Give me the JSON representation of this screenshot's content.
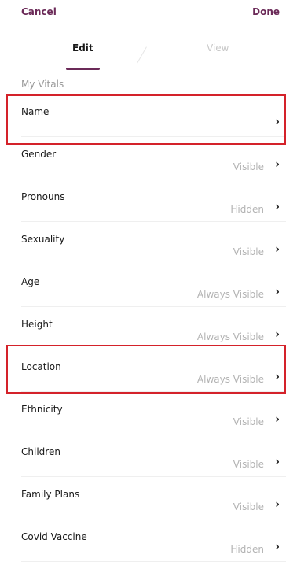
{
  "nav": {
    "cancel_label": "Cancel",
    "done_label": "Done"
  },
  "tabs": {
    "edit_label": "Edit",
    "view_label": "View"
  },
  "section": {
    "title": "My Vitals"
  },
  "rows": [
    {
      "label": "Name",
      "value": ""
    },
    {
      "label": "Gender",
      "value": "Visible"
    },
    {
      "label": "Pronouns",
      "value": "Hidden"
    },
    {
      "label": "Sexuality",
      "value": "Visible"
    },
    {
      "label": "Age",
      "value": "Always Visible"
    },
    {
      "label": "Height",
      "value": "Always Visible"
    },
    {
      "label": "Location",
      "value": "Always Visible"
    },
    {
      "label": "Ethnicity",
      "value": "Visible"
    },
    {
      "label": "Children",
      "value": "Visible"
    },
    {
      "label": "Family Plans",
      "value": "Visible"
    },
    {
      "label": "Covid Vaccine",
      "value": "Hidden"
    }
  ],
  "icons": {
    "chevron": "chevron-right-icon",
    "chevron_glyph": "›"
  },
  "colors": {
    "accent": "#6b2a58",
    "highlight": "#d4222a"
  }
}
